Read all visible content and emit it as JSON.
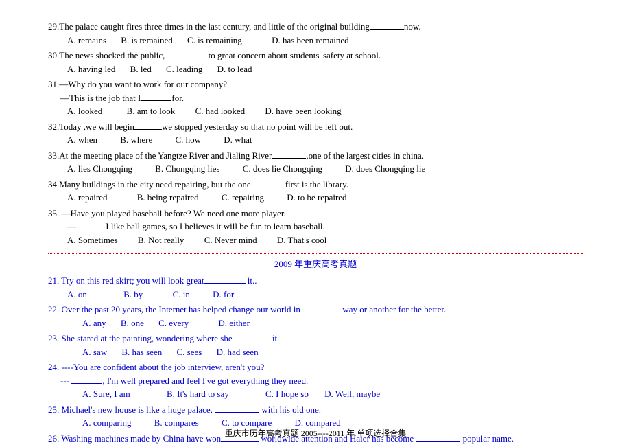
{
  "section1": {
    "questions": [
      {
        "num": "29.",
        "text_pre": "The palace caught fires three times in the last century, and little of the original building",
        "text_post": "now.",
        "opts": [
          "A. remains",
          "B. is remained",
          "C. is remaining",
          "D. has been remained"
        ]
      },
      {
        "num": "30.",
        "text_pre": "The news shocked the public, ",
        "text_post": "to great concern    about students' safety at school.",
        "opts": [
          "A. having led",
          "B. led",
          "C. leading",
          "D. to lead"
        ]
      },
      {
        "num": "31.",
        "line1": "—Why do you want to work for our company?",
        "line2_pre": "—This is the job that I",
        "line2_post": "for.",
        "opts": [
          "A. looked",
          "B. am to look",
          "C. had looked",
          "D. have been looking"
        ]
      },
      {
        "num": "32.",
        "text_pre": "Today ,we will begin",
        "text_post": "we stopped yesterday    so that no point will be left out.",
        "opts": [
          "A. when",
          "B. where",
          "C. how",
          "D. what"
        ]
      },
      {
        "num": "33.",
        "text_pre": "At the meeting place    of the Yangtze River and Jialing River",
        "text_post": ",one of the largest cities in china.",
        "opts": [
          "A. lies Chongqing",
          "B. Chongqing lies",
          "C. does lie Chongqing",
          "D. does Chongqing lie"
        ]
      },
      {
        "num": "34.",
        "text_pre": "Many buildings in the city need repairing, but the one",
        "text_post": "first is the library.",
        "opts": [
          "A. repaired",
          "B. being repaired",
          "C. repairing",
          "D. to be repaired"
        ]
      },
      {
        "num": "35.",
        "line1": " —Have you played baseball before? We need one more player.",
        "line2_pre": "—  ",
        "line2_post": "I like ball games, so I believes it will be fun to learn baseball.",
        "opts": [
          "A. Sometimes",
          "B. Not really",
          "C. Never mind",
          "D. That's cool"
        ]
      }
    ]
  },
  "section2": {
    "title": "2009 年重庆高考真题",
    "questions": [
      {
        "num": "21.",
        "text_pre": " Try on this red skirt; you will look great",
        "text_post": "  it..",
        "opts": [
          "A. on",
          "B. by",
          "C. in",
          "D. for"
        ]
      },
      {
        "num": "22.",
        "text_pre": " Over the past 20 years, the Internet has helped change our world in  ",
        "text_post": "  way or another for the better.",
        "opts": [
          "A. any",
          "B. one",
          "C. every",
          "D. either"
        ]
      },
      {
        "num": "23.",
        "text_pre": " She stared at the painting, wondering where she  ",
        "text_post": "it.",
        "opts": [
          "A. saw",
          "B. has seen",
          "C. sees",
          "D. had seen"
        ]
      },
      {
        "num": "24.",
        "line1": " ----You are confident about the job interview, aren't you?",
        "line2_pre": "--- ",
        "line2_post": ", I'm well prepared and feel I've got everything they need.",
        "opts": [
          "A. Sure, I am",
          "B. It's hard to say",
          "C. I hope so",
          "D. Well, maybe"
        ]
      },
      {
        "num": "25.",
        "text_pre": " Michael's new house is like a huge palace, ",
        "text_post": "  with his old one.",
        "opts": [
          "A. comparing",
          "B. compares",
          "C. to compare",
          "D. compared"
        ]
      },
      {
        "num": "26.",
        "text_pre": " Washing machines made by China have won",
        "text_mid": "  worldwide attention and Haier has become  ",
        "text_post": "  popular name.",
        "opts": []
      }
    ]
  },
  "footer": "重庆市历年高考真题  2005----2011 年  单项选择合集"
}
